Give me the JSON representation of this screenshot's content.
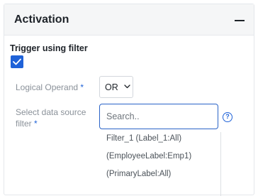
{
  "panel": {
    "title": "Activation",
    "collapse_icon": "minus-icon"
  },
  "trigger": {
    "label": "Trigger using filter",
    "checked": true,
    "check_icon": "check-icon"
  },
  "logical_operand": {
    "label": "Logical Operand",
    "required_mark": "*",
    "value": "OR",
    "chevron_icon": "chevron-down-icon"
  },
  "data_source_filter": {
    "label": "Select data source filter",
    "required_mark": "*",
    "placeholder": "Search..",
    "help_icon": "question-circle-icon",
    "help_glyph": "?",
    "options": [
      "Filter_1 (Label_1:All)",
      "(EmployeeLabel:Emp1)",
      "(PrimaryLabel:All)"
    ]
  },
  "colors": {
    "accent": "#1f62d8",
    "header_bg": "#f5f6f7",
    "label_gray": "#8a9199",
    "text_dark": "#1e2329"
  }
}
